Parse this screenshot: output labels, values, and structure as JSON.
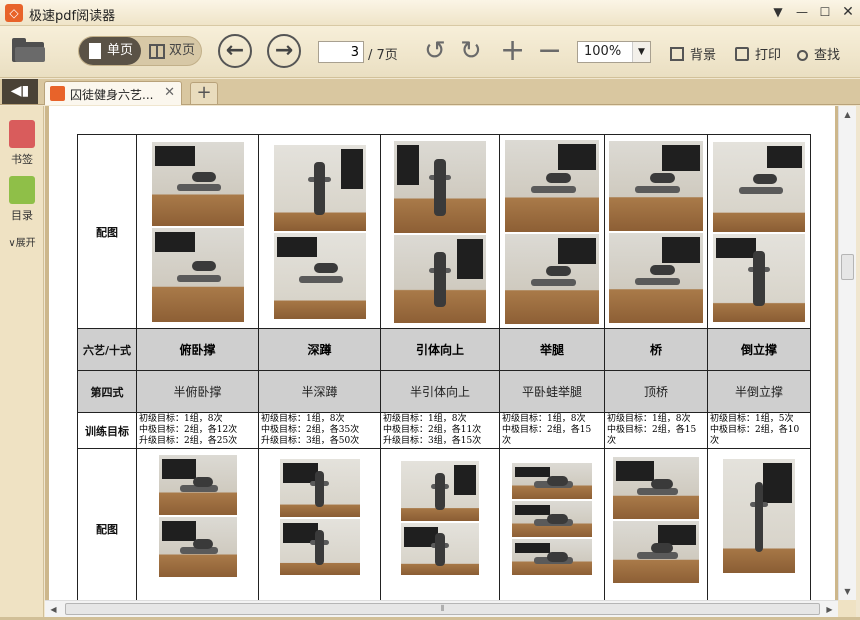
{
  "window": {
    "title": "极速pdf阅读器",
    "logo_icon": "app-logo-icon",
    "controls": [
      "menu-dropdown-icon",
      "minimize-icon",
      "maximize-icon",
      "close-icon"
    ]
  },
  "toolbar": {
    "open_icon": "folder-icon",
    "single_page_label": "单页",
    "double_page_label": "双页",
    "current_page": "3",
    "total_pages": "/ 7页",
    "zoom_value": "100%",
    "background_label": "背景",
    "print_label": "打印",
    "find_label": "查找"
  },
  "tabs": {
    "active_title": "囚徒健身六艺...",
    "close_glyph": "✕",
    "new_tab_glyph": "+"
  },
  "left_rail": {
    "bookmark_label": "书签",
    "toc_label": "目录",
    "expand_label": "展开"
  },
  "document": {
    "row_headers": {
      "figure": "配图",
      "six_arts": "六艺/十式",
      "fourth_style": "第四式",
      "training_goal": "训练目标",
      "figure2": "配图"
    },
    "exercises": [
      "俯卧撑",
      "深蹲",
      "引体向上",
      "举腿",
      "桥",
      "倒立撑"
    ],
    "fourth_styles": [
      "半俯卧撑",
      "半深蹲",
      "半引体向上",
      "平卧蛙举腿",
      "顶桥",
      "半倒立撑"
    ],
    "goals": [
      [
        "初级目标：1组，8次",
        "中极目标：2组，各12次",
        "升级目标：2组，各25次"
      ],
      [
        "初级目标：1组，8次",
        "中极目标：2组，各35次",
        "升级目标：3组，各50次"
      ],
      [
        "初级目标：1组，8次",
        "中极目标：2组，各11次",
        "升级目标：3组，各15次"
      ],
      [
        "初级目标：1组，8次",
        "中极目标：2组，各15",
        "次"
      ],
      [
        "初级目标：1组，8次",
        "中极目标：2组，各15",
        "次"
      ],
      [
        "初级目标：1组，5次",
        "中极目标：2组，各10",
        "次"
      ]
    ]
  }
}
